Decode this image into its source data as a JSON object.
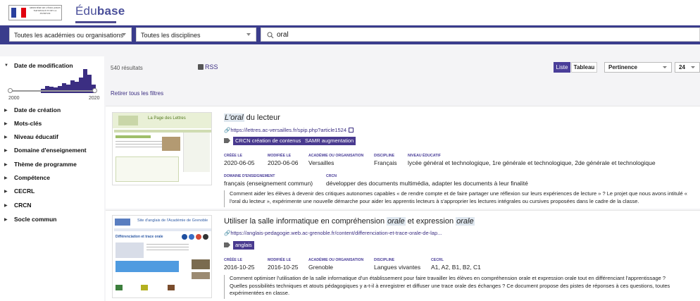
{
  "header": {
    "ministry_logo_text": "MINISTÈRE DE L'ÉDUCATION NATIONALE ET DE LA JEUNESSE",
    "logo_part1": "Édu",
    "logo_part2": "base"
  },
  "search": {
    "academies_select": "Toutes les académies ou organisations",
    "disciplines_select": "Toutes les disciplines",
    "query": "oral"
  },
  "sidebar": {
    "facet_date_mod": "Date de modification",
    "year_min": "2000",
    "year_max": "2020",
    "facets": [
      "Date de création",
      "Mots-clés",
      "Niveau éducatif",
      "Domaine d'enseignement",
      "Thème de programme",
      "Compétence",
      "CECRL",
      "CRCN",
      "Socle commun"
    ]
  },
  "results": {
    "count": "540 résultats",
    "rss": "RSS",
    "clear_filters": "Retirer tous les filtres",
    "view_list": "Liste",
    "view_table": "Tableau",
    "sort": "Pertinence",
    "per_page": "24"
  },
  "cards": [
    {
      "title_em": "L'oral",
      "title_rest": " du lecteur",
      "link": "https://lettres.ac-versailles.fr/spip.php?article1524",
      "tags": [
        "CRCN création de contenus",
        "SAMR augmentation"
      ],
      "meta1": [
        {
          "label": "CRÉÉE LE",
          "value": "2020-06-05"
        },
        {
          "label": "MODIFIÉE LE",
          "value": "2020-06-06"
        },
        {
          "label": "ACADÉMIE OU ORGANISATION",
          "value": "Versailles"
        },
        {
          "label": "DISCIPLINE",
          "value": "Français"
        },
        {
          "label": "NIVEAU ÉDUCATIF",
          "value": "lycée général et technologique, 1re générale et technologique, 2de générale et technologique"
        }
      ],
      "meta2": [
        {
          "label": "DOMAINE D'ENSEIGNEMENT",
          "value": "français (enseignement commun)"
        },
        {
          "label": "CRCN",
          "value": "développer des documents multimédia, adapter les documents à leur finalité"
        }
      ],
      "desc_line1": "Comment aider les élèves à devenir des critiques autonomes capables « de rendre compte et de faire partager une réflexion sur leurs expériences de lecture » ? Le projet que nous avons intitulé «",
      "desc_line2": "l'oral du lecteur », expérimente une nouvelle démarche pour aider les apprentis lecteurs à s'approprier les lectures intégrales ou cursives proposées dans le cadre de la classe.",
      "thumb_title": "La Page des Lettres"
    },
    {
      "title_pre": "Utiliser la salle informatique en compréhension ",
      "title_em1": "orale",
      "title_mid": " et expression ",
      "title_em2": "orale",
      "link": "https://anglais-pedagogie.web.ac-grenoble.fr/content/differenciation-et-trace-orale-de-lap...",
      "tags": [
        "anglais"
      ],
      "meta1": [
        {
          "label": "CRÉÉE LE",
          "value": "2016-10-25"
        },
        {
          "label": "MODIFIÉE LE",
          "value": "2016-10-25"
        },
        {
          "label": "ACADÉMIE OU ORGANISATION",
          "value": "Grenoble"
        },
        {
          "label": "DISCIPLINE",
          "value": "Langues vivantes"
        },
        {
          "label": "CECRL",
          "value": "A1, A2, B1, B2, C1"
        }
      ],
      "desc_line1": "Comment optimiser l'utilisation de la salle informatique d'un établissement pour faire travailler les élèves en compréhension orale et expression orale tout en différenciant l'apprentissage ?",
      "desc_line2": "Quelles possibilités techniques et atouts pédagogiques y a-t-il à enregistrer et diffuser une trace orale des échanges ? Ce document propose des pistes de réponses à ces questions, toutes",
      "desc_line3": "expérimentées en classe.",
      "thumb_title": "Site d'anglais de l'Académie de Grenoble",
      "thumb_sub": "Différenciation et trace orale"
    }
  ],
  "colors": {
    "brand": "#3a3c8c",
    "accent": "#493a8f"
  }
}
